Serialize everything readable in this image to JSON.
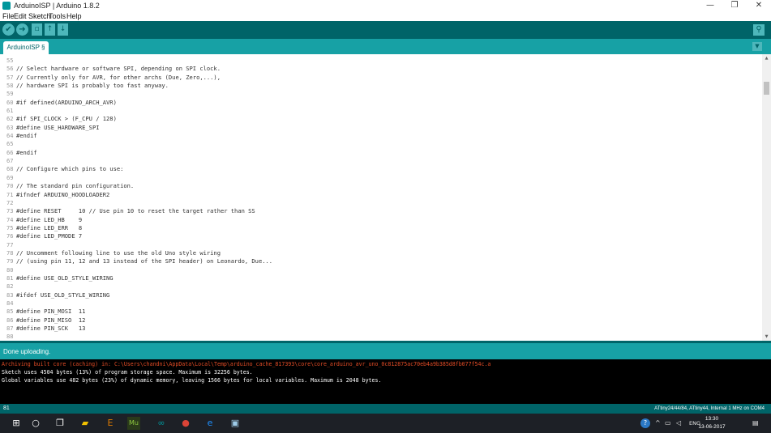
{
  "window": {
    "title": "ArduinoISP | Arduino 1.8.2",
    "controls": [
      "—",
      "❐",
      "✕"
    ]
  },
  "menu": [
    "File",
    "Edit",
    "Sketch",
    "Tools",
    "Help"
  ],
  "toolbar": {
    "verify_icon": "✔",
    "upload_icon": "➜",
    "new_icon": "▫",
    "open_icon": "↑",
    "save_icon": "↓",
    "serial_icon": "⚲"
  },
  "tab": {
    "label": "ArduinoISP §",
    "menu_icon": "▼"
  },
  "editor": {
    "lines": [
      {
        "num": "55",
        "code": ""
      },
      {
        "num": "56",
        "code": "// Select hardware or software SPI, depending on SPI clock."
      },
      {
        "num": "57",
        "code": "// Currently only for AVR, for other archs (Due, Zero,...),"
      },
      {
        "num": "58",
        "code": "// hardware SPI is probably too fast anyway."
      },
      {
        "num": "59",
        "code": ""
      },
      {
        "num": "60",
        "code": "#if defined(ARDUINO_ARCH_AVR)"
      },
      {
        "num": "61",
        "code": ""
      },
      {
        "num": "62",
        "code": "#if SPI_CLOCK > (F_CPU / 128)"
      },
      {
        "num": "63",
        "code": "#define USE_HARDWARE_SPI"
      },
      {
        "num": "64",
        "code": "#endif"
      },
      {
        "num": "65",
        "code": ""
      },
      {
        "num": "66",
        "code": "#endif"
      },
      {
        "num": "67",
        "code": ""
      },
      {
        "num": "68",
        "code": "// Configure which pins to use:"
      },
      {
        "num": "69",
        "code": ""
      },
      {
        "num": "70",
        "code": "// The standard pin configuration."
      },
      {
        "num": "71",
        "code": "#ifndef ARDUINO_HOODLOADER2"
      },
      {
        "num": "72",
        "code": ""
      },
      {
        "num": "73",
        "code": "#define RESET     10 // Use pin 10 to reset the target rather than SS"
      },
      {
        "num": "74",
        "code": "#define LED_HB    9"
      },
      {
        "num": "75",
        "code": "#define LED_ERR   8"
      },
      {
        "num": "76",
        "code": "#define LED_PMODE 7"
      },
      {
        "num": "77",
        "code": ""
      },
      {
        "num": "78",
        "code": "// Uncomment following line to use the old Uno style wiring"
      },
      {
        "num": "79",
        "code": "// (using pin 11, 12 and 13 instead of the SPI header) on Leonardo, Due..."
      },
      {
        "num": "80",
        "code": ""
      },
      {
        "num": "81",
        "code": "#define USE_OLD_STYLE_WIRING"
      },
      {
        "num": "82",
        "code": ""
      },
      {
        "num": "83",
        "code": "#ifdef USE_OLD_STYLE_WIRING"
      },
      {
        "num": "84",
        "code": ""
      },
      {
        "num": "85",
        "code": "#define PIN_MOSI  11"
      },
      {
        "num": "86",
        "code": "#define PIN_MISO  12"
      },
      {
        "num": "87",
        "code": "#define PIN_SCK   13"
      },
      {
        "num": "88",
        "code": ""
      }
    ]
  },
  "status": {
    "message": "Done uploading."
  },
  "console": {
    "lines": [
      {
        "text": "Archiving built core (caching) in: C:\\Users\\chandni\\AppData\\Local\\Temp\\arduino_cache_817393\\core\\core_arduino_avr_uno_0c812875ac70eb4a9b385d8fb077f54c.a",
        "color": "#e34c26"
      },
      {
        "text": "Sketch uses 4504 bytes (13%) of program storage space. Maximum is 32256 bytes.",
        "color": "#ffffff"
      },
      {
        "text": "Global variables use 482 bytes (23%) of dynamic memory, leaving 1566 bytes for local variables. Maximum is 2048 bytes.",
        "color": "#ffffff"
      }
    ]
  },
  "footer": {
    "line_number": "81",
    "board": "ATtiny24/44/84, ATtiny44, Internal 1 MHz on COM4"
  },
  "taskbar": {
    "start_icon": "⊞",
    "cortana_icon": "○",
    "taskview_icon": "❐",
    "apps": [
      {
        "name": "file-explorer-icon",
        "glyph": "▰",
        "color": "#f0c000"
      },
      {
        "name": "app-e-icon",
        "glyph": "E",
        "color": "#e07b00"
      },
      {
        "name": "muse-icon",
        "glyph": "Mu",
        "color": "#8cc63f"
      },
      {
        "name": "arduino-icon",
        "glyph": "∞",
        "color": "#00979c"
      },
      {
        "name": "chrome-icon",
        "glyph": "●",
        "color": "#db4437"
      },
      {
        "name": "edge-icon",
        "glyph": "e",
        "color": "#1e90ff"
      },
      {
        "name": "photos-icon",
        "glyph": "▣",
        "color": "#9ecbe8"
      }
    ],
    "tray_help": "?",
    "tray_chevron": "^",
    "tray_network": "▭",
    "tray_volume": "◁",
    "language": "ENG",
    "time": "13:30",
    "date": "13-06-2017",
    "notification_icon": "▤"
  },
  "colors": {
    "teal_dark": "#006468",
    "teal_mid": "#17a1a5",
    "console_error": "#e34c26"
  }
}
